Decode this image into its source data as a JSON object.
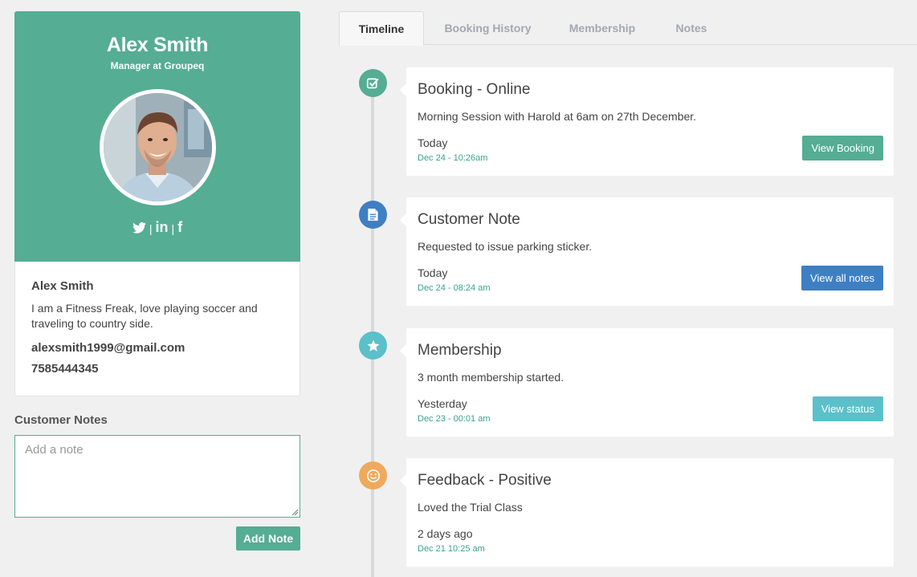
{
  "profile": {
    "name": "Alex Smith",
    "role": "Manager at Groupeq",
    "socials": [
      {
        "icon": "twitter-icon"
      },
      {
        "icon": "linkedin-icon",
        "text": "in"
      },
      {
        "icon": "facebook-icon",
        "text": "f"
      }
    ],
    "separator": "|",
    "accent_color": "#55ad93"
  },
  "about": {
    "name": "Alex Smith",
    "bio": "I am a Fitness Freak, love playing soccer and traveling to country side.",
    "email": "alexsmith1999@gmail.com",
    "phone": "7585444345"
  },
  "notes": {
    "title": "Customer Notes",
    "placeholder": "Add a note",
    "value": "",
    "add_button": "Add Note"
  },
  "tabs": [
    {
      "label": "Timeline",
      "active": true
    },
    {
      "label": "Booking History",
      "active": false
    },
    {
      "label": "Membership",
      "active": false
    },
    {
      "label": "Notes",
      "active": false
    }
  ],
  "timeline": [
    {
      "title": "Booking - Online",
      "description": "Morning Session with Harold at 6am on 27th December.",
      "when": "Today",
      "date": "Dec 24 - 10:26am",
      "icon": "checkbox-icon",
      "icon_color": "#55ad93",
      "button": {
        "label": "View Booking",
        "color": "#55ad93"
      }
    },
    {
      "title": "Customer Note",
      "description": "Requested to issue parking sticker.",
      "when": "Today",
      "date": "Dec 24 - 08:24 am",
      "icon": "document-icon",
      "icon_color": "#3e7fc4",
      "button": {
        "label": "View all notes",
        "color": "#3e7fc4"
      }
    },
    {
      "title": "Membership",
      "description": "3 month membership started.",
      "when": "Yesterday",
      "date": "Dec 23 - 00:01 am",
      "icon": "star-icon",
      "icon_color": "#5bc0c9",
      "button": {
        "label": "View status",
        "color": "#5bc0c9"
      }
    },
    {
      "title": "Feedback - Positive",
      "description": "Loved the Trial Class",
      "when": "2 days ago",
      "date": "Dec 21 10:25 am",
      "icon": "smiley-icon",
      "icon_color": "#f0a95c"
    }
  ]
}
